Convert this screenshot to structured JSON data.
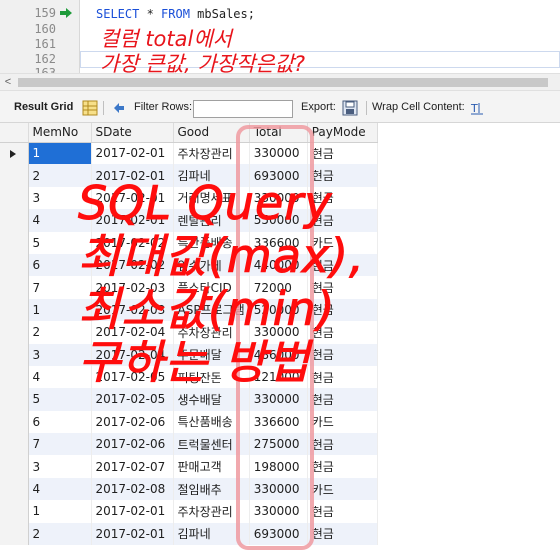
{
  "editor": {
    "line_numbers": [
      "159",
      "160",
      "161",
      "162",
      "163"
    ],
    "sql": {
      "kw1": "SELECT",
      "star": " * ",
      "kw2": "FROM",
      "table": " mbSales;"
    },
    "handwritten_line1": "컬럼 total에서",
    "handwritten_line2": "가장 큰값, 가장작은값?"
  },
  "scrollbar": {
    "left_arrow": "<"
  },
  "toolbar": {
    "result_grid": "Result Grid",
    "filter_rows": "Filter Rows:",
    "filter_value": "",
    "export": "Export:",
    "wrap_cell": "Wrap Cell Content:"
  },
  "grid": {
    "columns": [
      "MemNo",
      "SDate",
      "Good",
      "Total",
      "PayMode"
    ],
    "rows": [
      [
        "1",
        "2017-02-01",
        "주차장관리",
        "330000",
        "현금"
      ],
      [
        "2",
        "2017-02-01",
        "김파네",
        "693000",
        "현금"
      ],
      [
        "3",
        "2017-02-01",
        "거래명세표",
        "330000",
        "현금"
      ],
      [
        "4",
        "2017-02-01",
        "렌탈관리",
        "550000",
        "현금"
      ],
      [
        "5",
        "2017-02-02",
        "특산품배송",
        "336600",
        "카드"
      ],
      [
        "6",
        "2017-02-02",
        "임수가게",
        "440000",
        "현금"
      ],
      [
        "7",
        "2017-02-03",
        "플스타CID",
        "72000",
        "현금"
      ],
      [
        "1",
        "2017-02-03",
        "ASP프로그램",
        "520000",
        "현금"
      ],
      [
        "2",
        "2017-02-04",
        "주차장관리",
        "330000",
        "현금"
      ],
      [
        "3",
        "2017-02-04",
        "주문배달",
        "486000",
        "현금"
      ],
      [
        "4",
        "2017-02-05",
        "피팅잔돈",
        "121000",
        "현금"
      ],
      [
        "5",
        "2017-02-05",
        "생수배달",
        "330000",
        "현금"
      ],
      [
        "6",
        "2017-02-06",
        "특산품배송",
        "336600",
        "카드"
      ],
      [
        "7",
        "2017-02-06",
        "트럭물센터",
        "275000",
        "현금"
      ],
      [
        "3",
        "2017-02-07",
        "판매고객",
        "198000",
        "현금"
      ],
      [
        "4",
        "2017-02-08",
        "절임배추",
        "330000",
        "카드"
      ],
      [
        "1",
        "2017-02-01",
        "주차장관리",
        "330000",
        "현금"
      ],
      [
        "2",
        "2017-02-01",
        "김파네",
        "693000",
        "현금"
      ]
    ]
  },
  "overlay": {
    "line1": "SQL Query",
    "line2": "최대값(max),",
    "line3": "최소값(min)",
    "line4": "구하는 방법"
  },
  "colors": {
    "keyword": "#1a4fd8",
    "handwriting": "#e8141b",
    "selection": "#1f6fd6",
    "highlight_box": "#ee9aa0"
  },
  "icons": [
    "execute-arrow-icon",
    "grid-icon",
    "refresh-icon",
    "export-icon",
    "wrap-cell-icon"
  ]
}
